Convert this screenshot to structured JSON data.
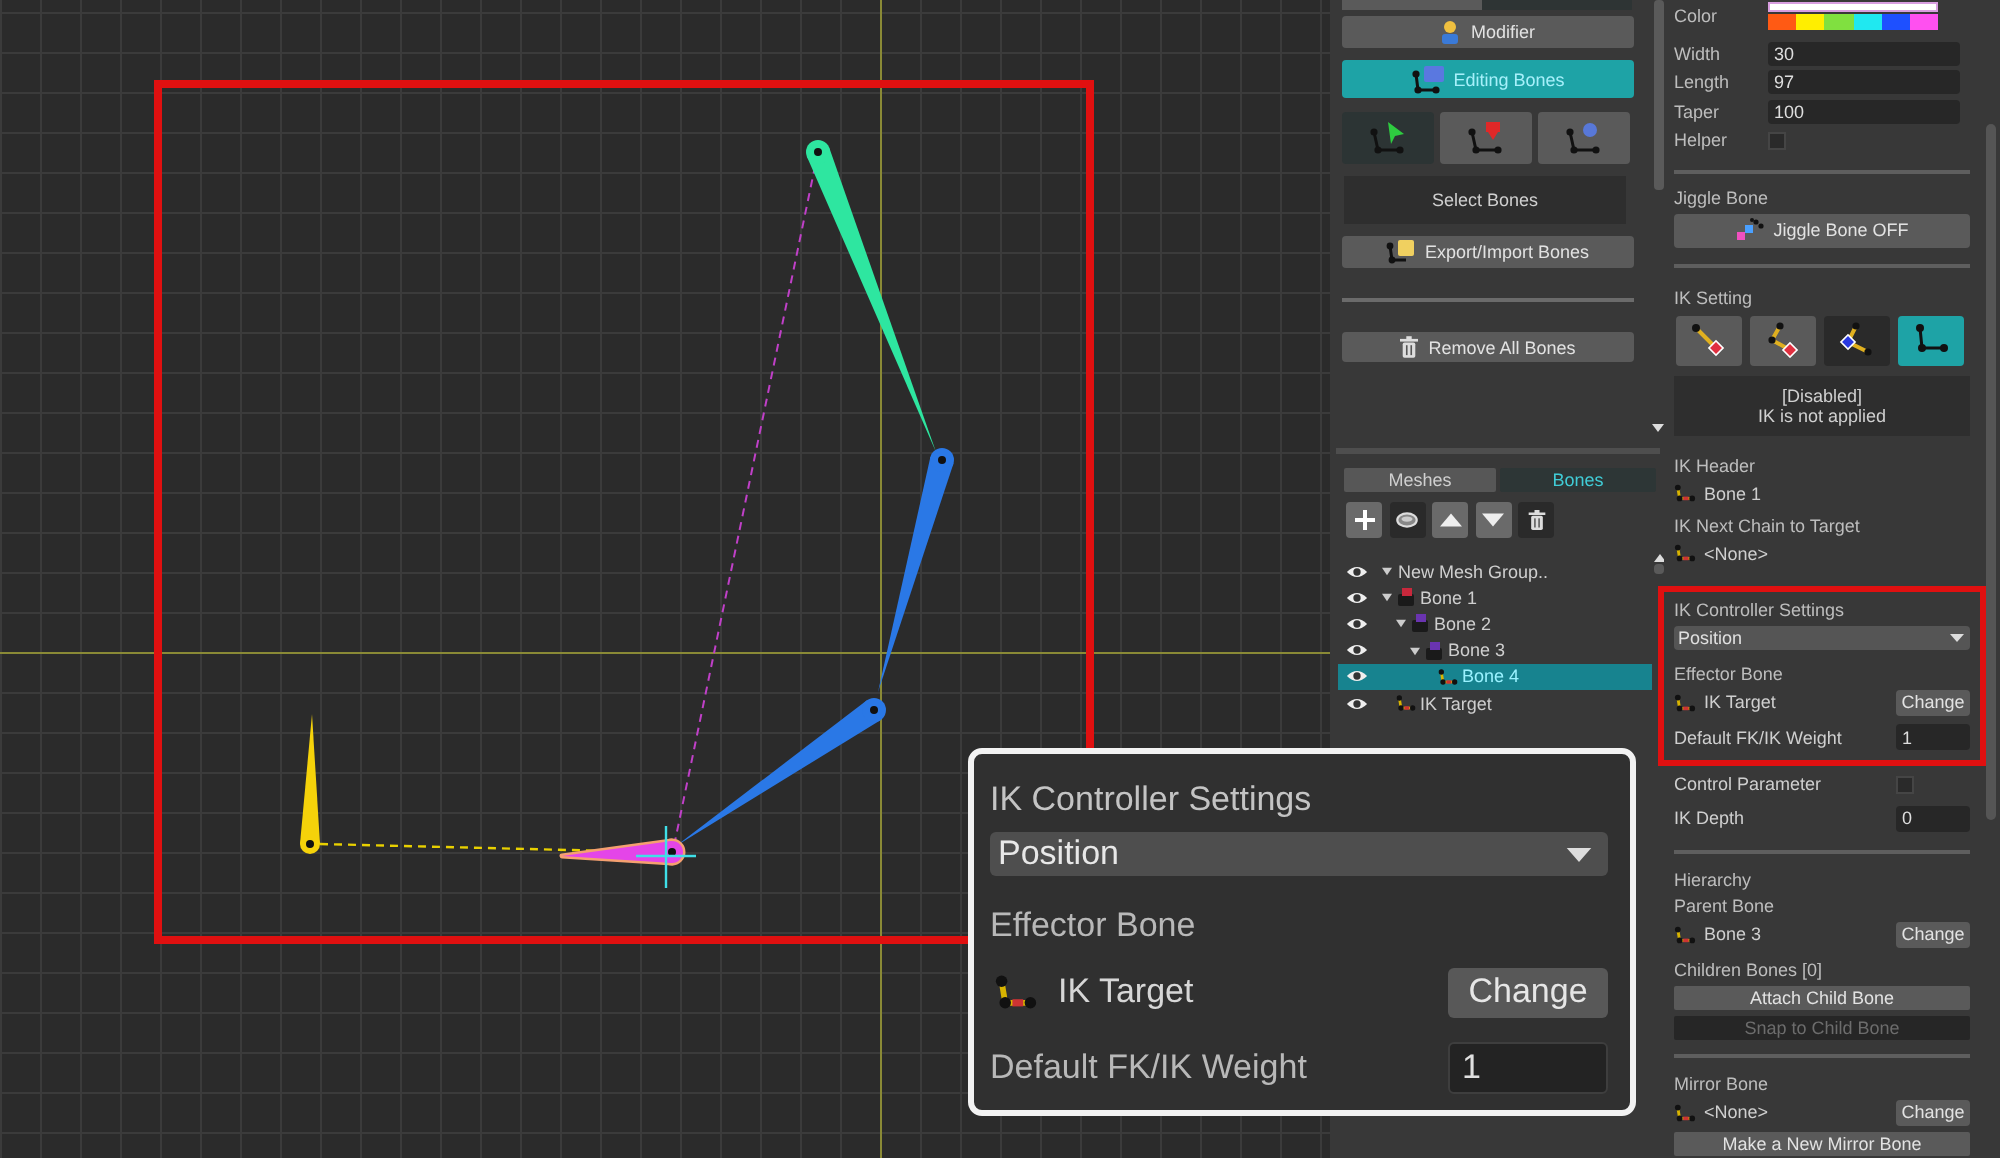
{
  "viewport": {
    "bones": [
      {
        "color": "#2ee6a0",
        "selected": false
      },
      {
        "color": "#2a78e6",
        "selected": false
      },
      {
        "color": "#2a78e6",
        "selected": false
      },
      {
        "color": "#e445e8",
        "selected": true
      },
      {
        "color": "#f5d20a",
        "selected": false
      }
    ]
  },
  "left_panel": {
    "mode_tabs": [
      {
        "selected": false
      },
      {
        "selected": true
      }
    ],
    "modifier_button": "Modifier",
    "editing_bones": {
      "label": "Editing Bones",
      "on": true
    },
    "tools": [
      {
        "kind": "select",
        "selected": true
      },
      {
        "kind": "add",
        "selected": false
      },
      {
        "kind": "link",
        "selected": false
      }
    ],
    "select_hint": "Select Bones",
    "export_button": "Export/Import Bones",
    "remove_button": "Remove All Bones",
    "list_tabs": [
      {
        "label": "Meshes",
        "selected": false
      },
      {
        "label": "Bones",
        "selected": true
      }
    ],
    "toolbar": [
      {
        "kind": "add"
      },
      {
        "kind": "mesh"
      },
      {
        "kind": "up"
      },
      {
        "kind": "down"
      },
      {
        "kind": "delete"
      }
    ],
    "tree": [
      {
        "label": "New Mesh Group..",
        "expanded": true,
        "selected": false,
        "children": [
          {
            "label": "Bone 1",
            "kind": "bone",
            "color": "#c8283c",
            "expanded": true,
            "selected": false,
            "children": [
              {
                "label": "Bone 2",
                "kind": "bone",
                "color": "#6a34b0",
                "expanded": true,
                "selected": false,
                "children": [
                  {
                    "label": "Bone 3",
                    "kind": "bone",
                    "color": "#6a34b0",
                    "expanded": true,
                    "selected": false,
                    "children": [
                      {
                        "label": "Bone 4",
                        "kind": "chain",
                        "selected": true
                      }
                    ]
                  }
                ]
              }
            ]
          },
          {
            "label": "IK Target",
            "kind": "chain",
            "selected": false
          }
        ]
      }
    ]
  },
  "right_panel": {
    "color_label": "Color",
    "palette": [
      {
        "color": "#ff5a14"
      },
      {
        "color": "#ffee00"
      },
      {
        "color": "#80e040"
      },
      {
        "color": "#20e8f0"
      },
      {
        "color": "#1e50ff"
      },
      {
        "color": "#ff50f0"
      }
    ],
    "properties": [
      {
        "label": "Width",
        "value": "30"
      },
      {
        "label": "Length",
        "value": "97"
      },
      {
        "label": "Taper",
        "value": "100"
      }
    ],
    "helper": {
      "label": "Helper",
      "checked": false
    },
    "jiggle": {
      "title": "Jiggle Bone",
      "button": "Jiggle Bone OFF"
    },
    "ik_setting": {
      "title": "IK Setting",
      "options": [
        {
          "kind": "point",
          "selected": false,
          "highlighted": false
        },
        {
          "kind": "two_bone",
          "selected": false,
          "highlighted": false
        },
        {
          "kind": "look_at",
          "selected": false,
          "highlighted": true
        },
        {
          "kind": "none",
          "selected": true,
          "highlighted": false
        }
      ],
      "status_title": "[Disabled]",
      "status_note": "IK is not applied"
    },
    "ik_header": {
      "label": "IK Header",
      "bone": "Bone 1"
    },
    "ik_next_chain": {
      "label": "IK Next Chain to Target",
      "bone": "<None>"
    },
    "ik_controller": {
      "title": "IK Controller Settings",
      "mode": "Position",
      "effector_label": "Effector Bone",
      "effector": "IK Target",
      "change": "Change",
      "weight_label": "Default FK/IK Weight",
      "weight": "1"
    },
    "control_parameter": {
      "label": "Control Parameter",
      "checked": false
    },
    "ik_depth": {
      "label": "IK Depth",
      "value": "0"
    },
    "hierarchy": {
      "title": "Hierarchy",
      "parent_label": "Parent Bone",
      "parent": "Bone 3",
      "change": "Change",
      "children_label": "Children Bones [0]",
      "attach_button": "Attach Child Bone",
      "snap_button": {
        "label": "Snap to Child Bone",
        "disabled": true
      }
    },
    "mirror": {
      "label": "Mirror Bone",
      "bone": "<None>",
      "change": "Change",
      "button": "Make a New Mirror Bone"
    }
  },
  "callout": {
    "title": "IK Controller Settings",
    "mode": "Position",
    "effector_label": "Effector Bone",
    "effector": "IK Target",
    "change": "Change",
    "weight_label": "Default FK/IK Weight",
    "weight": "1"
  }
}
